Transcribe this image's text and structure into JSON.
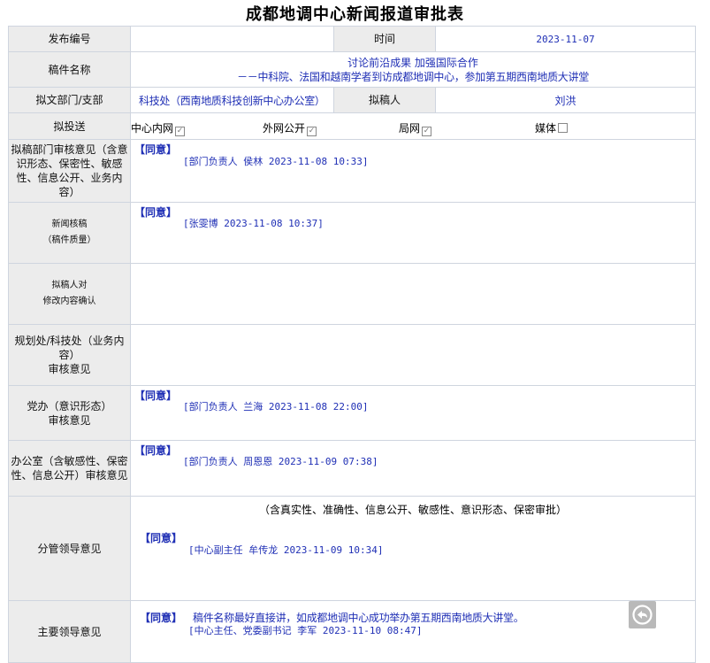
{
  "title": "成都地调中心新闻报道审批表",
  "rows": {
    "publish_no": {
      "label": "发布编号",
      "value": ""
    },
    "time": {
      "label": "时间",
      "value": "2023-11-07"
    },
    "article_name": {
      "label": "稿件名称",
      "line1": "讨论前沿成果 加强国际合作",
      "line2": "－－中科院、法国和越南学者到访成都地调中心，参加第五期西南地质大讲堂"
    },
    "dept": {
      "label": "拟文部门/支部",
      "value": "科技处（西南地质科技创新中心办公室）"
    },
    "drafter": {
      "label": "拟稿人",
      "value": "刘洪"
    },
    "channels": {
      "label": "拟投送",
      "items": [
        {
          "name": "中心内网",
          "checked": true,
          "mark": "✓"
        },
        {
          "name": "外网公开",
          "checked": true,
          "mark": "✓"
        },
        {
          "name": "局网",
          "checked": true,
          "mark": "✓"
        },
        {
          "name": "媒体",
          "checked": false,
          "mark": ""
        }
      ]
    },
    "dept_review": {
      "label": "拟稿部门审核意见（含意识形态、保密性、敏感性、信息公开、业务内容）",
      "opinion": "【同意】",
      "sign": "[部门负责人  侯林  2023-11-08 10:33]"
    },
    "news_review": {
      "label1": "新闻核稿",
      "label2": "（稿件质量）",
      "opinion": "【同意】",
      "sign": "[张雯博  2023-11-08 10:37]"
    },
    "drafter_confirm": {
      "label1": "拟稿人对",
      "label2": "修改内容确认"
    },
    "planning_review": {
      "label1": "规划处/科技处（业务内容）",
      "label2": "审核意见"
    },
    "party_review": {
      "label1": "党办（意识形态）",
      "label2": "审核意见",
      "opinion": "【同意】",
      "sign": "[部门负责人  兰海  2023-11-08 22:00]"
    },
    "office_review": {
      "label": "办公室（含敏感性、保密性、信息公开）审核意见",
      "opinion": "【同意】",
      "sign": "[部门负责人  周恩恩  2023-11-09 07:38]"
    },
    "leader_review": {
      "label": "分管领导意见",
      "note": "（含真实性、准确性、信息公开、敏感性、意识形态、保密审批）",
      "opinion": "【同意】",
      "sign": "[中心副主任  牟传龙  2023-11-09 10:34]"
    },
    "main_leader_review": {
      "label": "主要领导意见",
      "opinion": "【同意】",
      "comment": "稿件名称最好直接讲，如成都地调中心成功举办第五期西南地质大讲堂。",
      "sign": "[中心主任、党委副书记  李军  2023-11-10 08:47]"
    }
  },
  "colors": {
    "label_bg": "#ececec",
    "border": "#cfd5df",
    "text_blue": "#1f2fb5"
  },
  "icons": {
    "share": "share-arrow-icon"
  }
}
